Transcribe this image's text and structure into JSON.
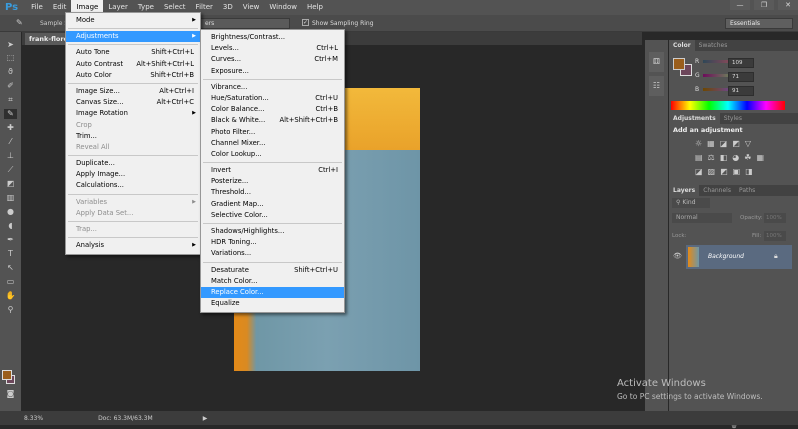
{
  "menubar": {
    "logo": "Ps",
    "items": [
      "File",
      "Edit",
      "Image",
      "Layer",
      "Type",
      "Select",
      "Filter",
      "3D",
      "View",
      "Window",
      "Help"
    ]
  },
  "window_controls": [
    "—",
    "❐",
    "✕"
  ],
  "options": {
    "sample_size_label": "Sample S",
    "sample_layers": "ers",
    "show_sampling_ring": "Show Sampling Ring",
    "checked": true,
    "workspace": "Essentials"
  },
  "document": {
    "tab": "frank-flores"
  },
  "image_menu": [
    {
      "label": "Mode",
      "submenu": true
    },
    {
      "sep": true
    },
    {
      "label": "Adjustments",
      "submenu": true,
      "highlighted": true
    },
    {
      "sep": true
    },
    {
      "label": "Auto Tone",
      "shortcut": "Shift+Ctrl+L"
    },
    {
      "label": "Auto Contrast",
      "shortcut": "Alt+Shift+Ctrl+L"
    },
    {
      "label": "Auto Color",
      "shortcut": "Shift+Ctrl+B"
    },
    {
      "sep": true
    },
    {
      "label": "Image Size...",
      "shortcut": "Alt+Ctrl+I"
    },
    {
      "label": "Canvas Size...",
      "shortcut": "Alt+Ctrl+C"
    },
    {
      "label": "Image Rotation",
      "submenu": true
    },
    {
      "label": "Crop",
      "disabled": true
    },
    {
      "label": "Trim..."
    },
    {
      "label": "Reveal All",
      "disabled": true
    },
    {
      "sep": true
    },
    {
      "label": "Duplicate..."
    },
    {
      "label": "Apply Image..."
    },
    {
      "label": "Calculations..."
    },
    {
      "sep": true
    },
    {
      "label": "Variables",
      "submenu": true,
      "disabled": true
    },
    {
      "label": "Apply Data Set...",
      "disabled": true
    },
    {
      "sep": true
    },
    {
      "label": "Trap...",
      "disabled": true
    },
    {
      "sep": true
    },
    {
      "label": "Analysis",
      "submenu": true
    }
  ],
  "adjustments_menu": [
    {
      "label": "Brightness/Contrast..."
    },
    {
      "label": "Levels...",
      "shortcut": "Ctrl+L"
    },
    {
      "label": "Curves...",
      "shortcut": "Ctrl+M"
    },
    {
      "label": "Exposure..."
    },
    {
      "sep": true
    },
    {
      "label": "Vibrance..."
    },
    {
      "label": "Hue/Saturation...",
      "shortcut": "Ctrl+U"
    },
    {
      "label": "Color Balance...",
      "shortcut": "Ctrl+B"
    },
    {
      "label": "Black & White...",
      "shortcut": "Alt+Shift+Ctrl+B"
    },
    {
      "label": "Photo Filter..."
    },
    {
      "label": "Channel Mixer..."
    },
    {
      "label": "Color Lookup..."
    },
    {
      "sep": true
    },
    {
      "label": "Invert",
      "shortcut": "Ctrl+I"
    },
    {
      "label": "Posterize..."
    },
    {
      "label": "Threshold..."
    },
    {
      "label": "Gradient Map..."
    },
    {
      "label": "Selective Color..."
    },
    {
      "sep": true
    },
    {
      "label": "Shadows/Highlights..."
    },
    {
      "label": "HDR Toning..."
    },
    {
      "label": "Variations..."
    },
    {
      "sep": true
    },
    {
      "label": "Desaturate",
      "shortcut": "Shift+Ctrl+U"
    },
    {
      "label": "Match Color..."
    },
    {
      "label": "Replace Color...",
      "highlighted": true
    },
    {
      "label": "Equalize"
    }
  ],
  "color_panel": {
    "tabs": [
      "Color",
      "Swatches"
    ],
    "r_label": "R",
    "g_label": "G",
    "b_label": "B",
    "r": "109",
    "g": "71",
    "b": "91",
    "foreground": "#9a5e1c",
    "background": "#6d475b"
  },
  "adjustments_panel": {
    "tabs": [
      "Adjustments",
      "Styles"
    ],
    "heading": "Add an adjustment"
  },
  "layers_panel": {
    "tabs": [
      "Layers",
      "Channels",
      "Paths"
    ],
    "filter": "Kind",
    "blend_mode": "Normal",
    "opacity_label": "Opacity:",
    "opacity": "100%",
    "lock_label": "Lock:",
    "fill_label": "Fill:",
    "fill": "100%",
    "layers": [
      {
        "name": "Background",
        "visible": true,
        "locked": true
      }
    ]
  },
  "status": {
    "zoom": "8.33%",
    "doc": "Doc: 63.3M/63.3M"
  },
  "watermark": {
    "title": "Activate Windows",
    "subtitle": "Go to PC settings to activate Windows."
  }
}
